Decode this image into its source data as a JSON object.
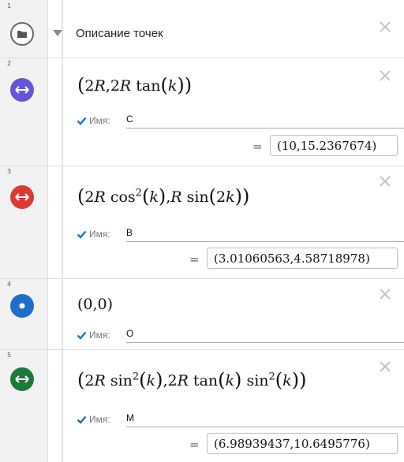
{
  "header": {
    "index": "1",
    "title": "Описание точек"
  },
  "name_label": "Имя:",
  "equals": "=",
  "items": [
    {
      "index": "2",
      "color": "#6557d2",
      "name": "C",
      "value": "(10,15.2367674)",
      "formula_parts": [
        "2R",
        ",2R tan",
        "k"
      ]
    },
    {
      "index": "3",
      "color": "#db3b34",
      "name": "B",
      "value": "(3.01060563,4.58718978)"
    },
    {
      "index": "4",
      "color": "#1d6fc9",
      "name": "O",
      "formula": "(0,0)"
    },
    {
      "index": "5",
      "color": "#1e7a3c",
      "name": "M",
      "value": "(6.98939437,10.6495776)"
    }
  ],
  "colors": {
    "checkbox": "#1d6fc9",
    "gutter": "#f2f2f2",
    "close": "#c4c4c4"
  }
}
